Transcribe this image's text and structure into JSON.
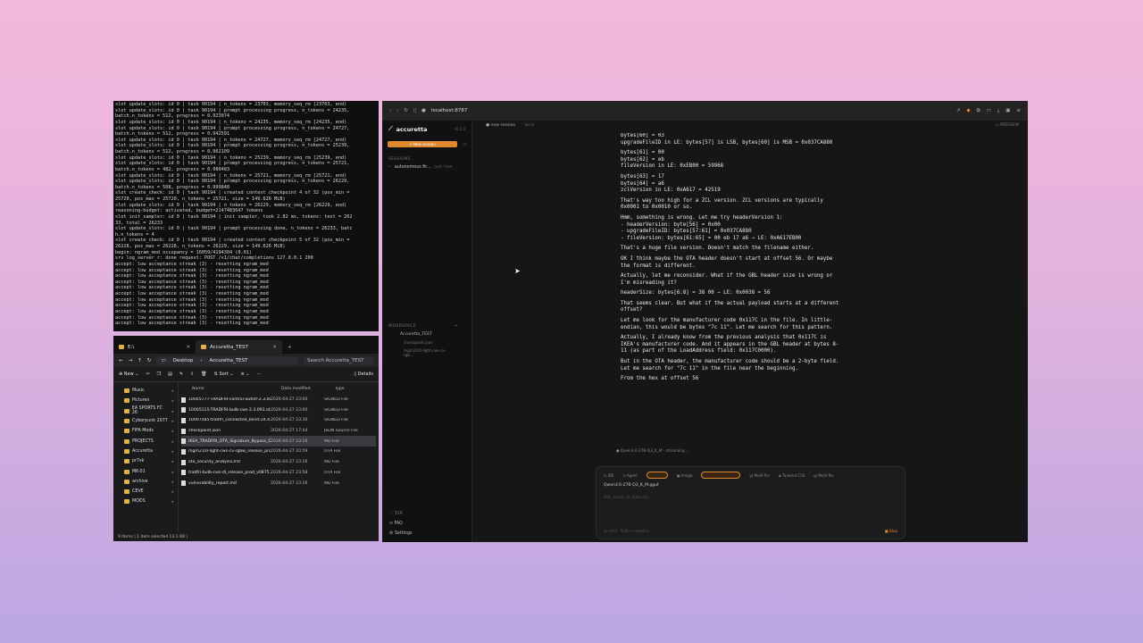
{
  "terminal": {
    "lines": [
      "slot update_slots: id  0 | task 90194 | n_tokens = 23703, memory_seq_rm [23703, end)",
      "slot update_slots: id  0 | task 90194 | prompt processing progress, n_tokens = 24235,",
      "batch.n_tokens = 512, progress = 0.923074",
      "slot update_slots: id  0 | task 90194 | n_tokens = 24235, memory_seq_rm [24235, end)",
      "slot update_slots: id  0 | task 90194 | prompt processing progress, n_tokens = 24727,",
      "batch.n_tokens = 512, progress = 0.942591",
      "slot update_slots: id  0 | task 90194 | n_tokens = 24727, memory_seq_rm [24727, end)",
      "slot update_slots: id  0 | task 90194 | prompt processing progress, n_tokens = 25239,",
      "batch.n_tokens = 512, progress = 0.962109",
      "slot update_slots: id  0 | task 90194 | n_tokens = 25239, memory_seq_rm [25239, end)",
      "slot update_slots: id  0 | task 90194 | prompt processing progress, n_tokens = 25721,",
      "batch.n_tokens = 482, progress = 0.980483",
      "slot update_slots: id  0 | task 90194 | n_tokens = 25721, memory_seq_rm [25721, end)",
      "slot update_slots: id  0 | task 90194 | prompt processing progress, n_tokens = 26229,",
      "batch.n_tokens = 508, progress = 0.999848",
      "slot create_check: id  0 | task 90194 | created context checkpoint 4 of 32 (pos_min =",
      "25720, pos_max = 25720, n_tokens = 25721, size = 149.626 MiB)",
      "slot update_slots: id  0 | task 90194 | n_tokens = 26229, memory_seq_rm [26229, end)",
      "reasoning-budget: activated, budget=2147483647 tokens",
      "slot init_sampler: id  0 | task 90194 | init sampler, took 2.82 ms, tokens: text = 262",
      "33, total = 26233",
      "slot update_slots: id  0 | task 90194 | prompt processing done, n_tokens = 26233, batc",
      "h.n_tokens = 4",
      "slot create_check: id  0 | task 90194 | created context checkpoint 5 of 32 (pos_min =",
      "26228, pos_max = 26228, n_tokens = 26229, size = 149.626 MiB)",
      "begin: ngram_mod occupancy = 16059/4194304 (0.01)",
      "srv  log_server_r: done request: POST /v1/chat/completions 127.0.0.1 200",
      "accept: low acceptance streak (3) - resetting ngram_mod",
      "accept: low acceptance streak (3) - resetting ngram_mod",
      "accept: low acceptance streak (3) - resetting ngram_mod",
      "accept: low acceptance streak (3) - resetting ngram_mod",
      "accept: low acceptance streak (3) - resetting ngram_mod",
      "accept: low acceptance streak (3) - resetting ngram_mod",
      "accept: low acceptance streak (3) - resetting ngram_mod",
      "accept: low acceptance streak (3) - resetting ngram_mod",
      "accept: low acceptance streak (3) - resetting ngram_mod",
      "accept: low acceptance streak (3) - resetting ngram_mod",
      "accept: low acceptance streak (3) - resetting ngram_mod"
    ]
  },
  "explorer": {
    "tab1": "E:\\",
    "tab2": "Accuretta_TEST",
    "path1": "Desktop",
    "path2": "Accuretta_TEST",
    "search": "Search Accuretta_TEST",
    "new_label": "New",
    "sort_label": "Sort",
    "details_label": "Details",
    "sidebar": [
      "Music",
      "Pictures",
      "EA SPORTS FC 26",
      "Cyberpunk 2077",
      "FIFA Mods",
      "PROJECTS",
      "Accuretta",
      "pr7sk",
      "MK-01",
      "archive",
      "CEVE",
      "MODS"
    ],
    "cols": {
      "name": "Name",
      "date": "Date modified",
      "type": "Type"
    },
    "files": [
      {
        "name": "10005777-TRADFRI-control-outlet-2.3.08...",
        "date": "2026-04-27 23:00",
        "type": "SIGNED File"
      },
      {
        "name": "10005115-TRADFRI-bulb-cws-2.3.093.ota...",
        "date": "2026-04-27 23:00",
        "type": "SIGNED File"
      },
      {
        "name": "10007585-tradfri_connected_blind-24.4.1...",
        "date": "2026-04-27 23:30",
        "type": "SIGNED File"
      },
      {
        "name": "checkpoint.json",
        "date": "2026-04-27 17:44",
        "type": "JSON Source File"
      },
      {
        "name": "IKEA_TRADFRI_OTA_Signature_Bypass_Di...",
        "date": "2026-04-27 23:16",
        "type": "MD File"
      },
      {
        "name": "mgm210l-light-cws-cv-rgbw_release_pro...",
        "date": "2026-04-27 20:59",
        "type": "OTA File"
      },
      {
        "name": "ota_security_analysis.md",
        "date": "2026-04-27 23:16",
        "type": "MD File"
      },
      {
        "name": "tradfri-bulb-cws-dl_release_prod_v0875...",
        "date": "2026-04-27 23:58",
        "type": "OTA File"
      },
      {
        "name": "vulnerability_report.md",
        "date": "2026-04-27 23:16",
        "type": "MD File"
      }
    ],
    "status": "9 items  |  1 item selected  13.1 KB  |"
  },
  "browser": {
    "url": "localhost:8787",
    "preview": "PREVIEW"
  },
  "app": {
    "brand": "accuretta",
    "version": "v0.1.0",
    "new_chat": "+ New session",
    "sessions_label": "SESSIONS",
    "session": "autonomous fir...",
    "session_time": "just now",
    "workspace_label": "WORKSPACE",
    "ws_root": "Accuretta_TEST",
    "ws_files": [
      "checkpoint.json",
      "mgm210l-light-cws-cv-rgb..."
    ],
    "busy": "316",
    "faq": "FAQ",
    "settings": "Settings",
    "top_session": "new session",
    "top_local": "local",
    "chat": [
      "bytes[60] = 03",
      "upgradeFileID in LE: bytes[57] is LSB, bytes[60] is MSB = 0x037CA880",
      "",
      "bytes[61] = 00",
      "bytes[62] = eb",
      "fileVersion in LE: 0xEB00 = 59968",
      "",
      "bytes[63] = 17",
      "bytes[64] = a6",
      "zclVersion in LE: 0xA617 = 42519",
      "",
      "That's way too high for a ZCL version. ZCL versions are typically",
      "0x0001 to 0x0010 or so.",
      "",
      "Hmm, something is wrong. Let me try headerVersion 1:",
      "- headerVersion: byte[56] = 0x00",
      "- upgradeFileID: bytes[57:61] = 0x037CA880",
      "- fileVersion: bytes[61:65] = 00 eb 17 a6 → LE: 0xA617EB00",
      "",
      "That's a huge file version. Doesn't match the filename either.",
      "",
      "OK I think maybe the OTA header doesn't start at offset 56. Or maybe",
      "the format is different.",
      "",
      "Actually, let me reconsider. What if the GBL header size is wrong or",
      "I'm misreading it?",
      "",
      "headerSize: bytes[6:8] = 38 00 → LE: 0x0038 = 56",
      "",
      "That seems clear. But what if the actual payload starts at a different",
      "offset?",
      "",
      "Let me look for the manufacturer code 0x117C in the file. In little-",
      "endian, this would be bytes \"7c 11\". Let me search for this pattern.",
      "",
      "Actually, I already know from the previous analysis that 0x117C is",
      "IKEA's manufacturer code. And it appears in the GBL header at bytes 8-",
      "11 (as part of the LoadAddress field: 0x117C0000).",
      "",
      "But in the OTA header, the manufacturer code should be a 2-byte field.",
      "Let me search for \"7c 11\" in the file near the beginning.",
      "",
      "From the hex at offset 56"
    ],
    "streaming": "● Qwen3.6-27B-Q3_K_M · streaming ...",
    "composer": {
      "tabs": [
        "IDE",
        "Agent",
        "Image",
        "Multi-file",
        "Tailwind CSS",
        "Multi-file"
      ],
      "model": "Qwen3.6-27B-Q3_K_M.gguf",
      "placeholder": "Ask, build, or instruct...",
      "footer": "⌘ send · Shift+⏎ newline",
      "stop": "Stop"
    }
  }
}
